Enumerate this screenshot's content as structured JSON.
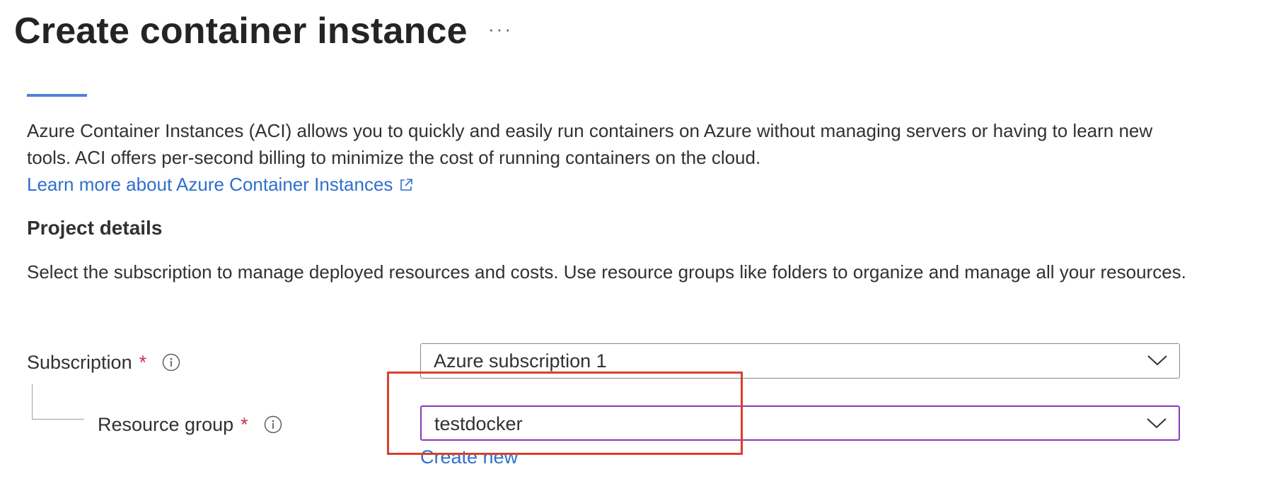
{
  "header": {
    "title": "Create container instance",
    "more_label": "···"
  },
  "intro": {
    "text": "Azure Container Instances (ACI) allows you to quickly and easily run containers on Azure without managing servers or having to learn new tools. ACI offers per-second billing to minimize the cost of running containers on the cloud.",
    "learn_more": "Learn more about Azure Container Instances",
    "learn_more_icon": "external-link-icon"
  },
  "project_details": {
    "title": "Project details",
    "description": "Select the subscription to manage deployed resources and costs. Use resource groups like folders to organize and manage all your resources."
  },
  "fields": {
    "subscription": {
      "label": "Subscription",
      "required_mark": "*",
      "value": "Azure subscription 1"
    },
    "resource_group": {
      "label": "Resource group",
      "required_mark": "*",
      "value": "testdocker",
      "create_new": "Create new"
    }
  },
  "colors": {
    "accent": "#4d83d6",
    "link": "#2f6fcd",
    "required": "#c4314b",
    "focused_border": "#8a3bb8",
    "highlight": "#d9402b"
  }
}
